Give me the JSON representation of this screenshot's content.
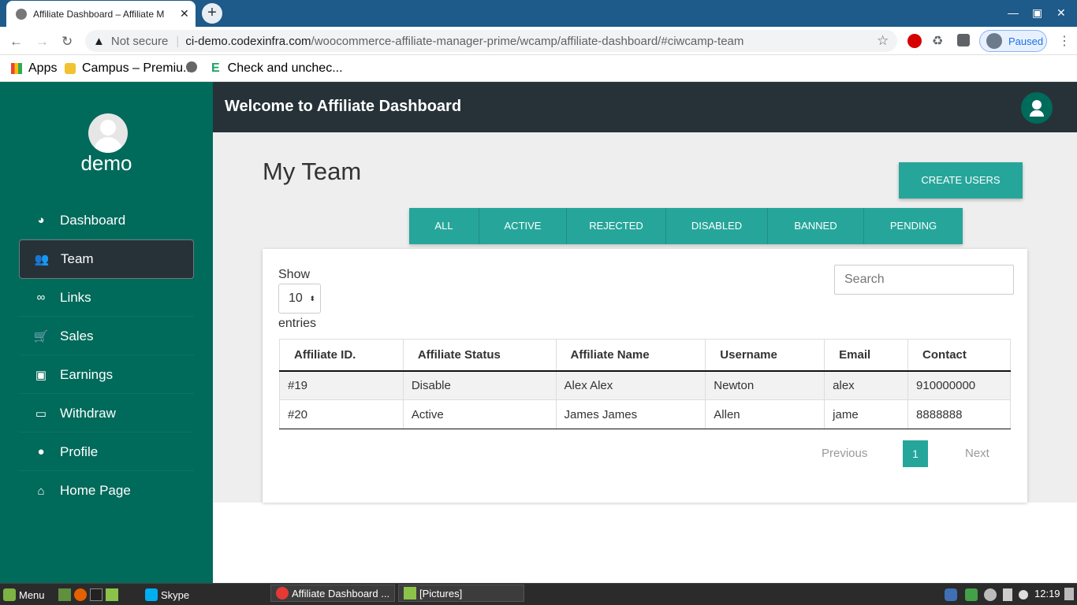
{
  "browser": {
    "tab_title": "Affiliate Dashboard – Affiliate M",
    "tab_close": "✕",
    "new_tab": "+",
    "not_secure": "Not secure",
    "url_domain": "ci-demo.codexinfra.com",
    "url_path": "/woocommerce-affiliate-manager-prime/wcamp/affiliate-dashboard/#ciwcamp-team",
    "profile_status": "Paused",
    "bookmarks": [
      "Apps",
      "Campus – Premiu...",
      "Check and unchec..."
    ]
  },
  "sidebar": {
    "username": "demo",
    "items": [
      {
        "label": "Dashboard",
        "icon": "pie-chart-icon"
      },
      {
        "label": "Team",
        "icon": "users-icon"
      },
      {
        "label": "Links",
        "icon": "link-icon"
      },
      {
        "label": "Sales",
        "icon": "cart-icon"
      },
      {
        "label": "Earnings",
        "icon": "money-icon"
      },
      {
        "label": "Withdraw",
        "icon": "credit-card-icon"
      },
      {
        "label": "Profile",
        "icon": "user-icon"
      },
      {
        "label": "Home Page",
        "icon": "home-icon"
      }
    ],
    "active": "Team"
  },
  "header": {
    "title": "Welcome to Affiliate Dashboard"
  },
  "main": {
    "page_title": "My Team",
    "create_button": "CREATE USERS",
    "filters": [
      "ALL",
      "ACTIVE",
      "REJECTED",
      "DISABLED",
      "BANNED",
      "PENDING"
    ],
    "show_label": "Show",
    "page_length": "10",
    "entries_label": "entries",
    "search_placeholder": "Search",
    "table": {
      "columns": [
        "Affiliate ID.",
        "Affiliate Status",
        "Affiliate Name",
        "Username",
        "Email",
        "Contact"
      ],
      "rows": [
        [
          "#19",
          "Disable",
          "Alex Alex",
          "Newton",
          "alex",
          "910000000"
        ],
        [
          "#20",
          "Active",
          "James James",
          "Allen",
          "jame",
          "8888888"
        ]
      ]
    },
    "pagination": {
      "previous": "Previous",
      "current": "1",
      "next": "Next"
    }
  },
  "taskbar": {
    "menu": "Menu",
    "apps": [
      "Skype",
      "Affiliate Dashboard ...",
      "[Pictures]"
    ],
    "clock": "12:19"
  },
  "colors": {
    "sidebar": "#006a5b",
    "topbar": "#263238",
    "accent": "#26a69a"
  }
}
